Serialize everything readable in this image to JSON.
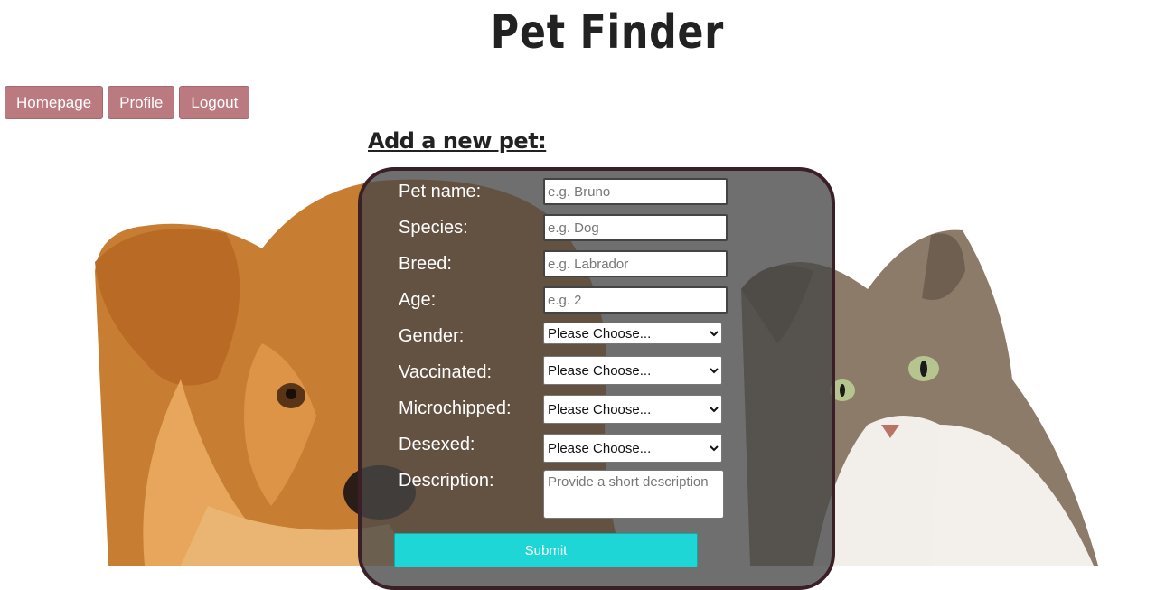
{
  "header": {
    "title": "Pet Finder"
  },
  "nav": {
    "homepage": "Homepage",
    "profile": "Profile",
    "logout": "Logout"
  },
  "form": {
    "heading": "Add a new pet:",
    "pet_name": {
      "label": "Pet name:",
      "placeholder": "e.g. Bruno"
    },
    "species": {
      "label": "Species:",
      "placeholder": "e.g. Dog"
    },
    "breed": {
      "label": "Breed:",
      "placeholder": "e.g. Labrador"
    },
    "age": {
      "label": "Age:",
      "placeholder": "e.g. 2"
    },
    "gender": {
      "label": "Gender:",
      "selected": "Please Choose..."
    },
    "vaccinated": {
      "label": "Vaccinated:",
      "selected": "Please Choose..."
    },
    "microchipped": {
      "label": "Microchipped:",
      "selected": "Please Choose..."
    },
    "desexed": {
      "label": "Desexed:",
      "selected": "Please Choose..."
    },
    "description": {
      "label": "Description:",
      "placeholder": "Provide a short description"
    },
    "submit": "Submit"
  },
  "colors": {
    "nav_button": "#bb7a80",
    "submit_button": "#1fd6d6",
    "panel_border": "#3b1f27",
    "panel_fill": "#464646"
  },
  "images": {
    "background": "dog and cat photo"
  }
}
